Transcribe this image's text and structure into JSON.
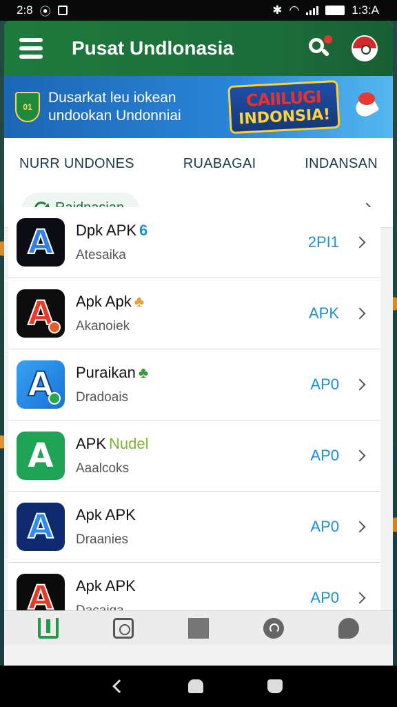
{
  "status_bar": {
    "time_left": "2:8",
    "time_right": "1:3:A"
  },
  "app_bar": {
    "title": "Pusat Undlonasia",
    "menu_icon": "hamburger-icon",
    "search_icon": "search-icon",
    "avatar_icon": "avatar-icon"
  },
  "banner": {
    "shield_text": "01",
    "text": "Dusarkat leu iokean undookan Undonniai",
    "promo_line1": "CAIILUGI",
    "promo_line2": "INDONSIA!"
  },
  "tabs": [
    {
      "label": "NURR UNDONES"
    },
    {
      "label": "RUABAGAI"
    },
    {
      "label": "INDANSAN"
    }
  ],
  "filter": {
    "chip_label": "Raidnasian"
  },
  "apps": [
    {
      "name": "Dpk APK",
      "accent": "6",
      "sub": "Atesaika",
      "tag": "2PI1",
      "icon_letter": "A"
    },
    {
      "name": "Apk Apk",
      "accent": "♣",
      "sub": "Akanoiek",
      "tag": "APK",
      "icon_letter": "A"
    },
    {
      "name": "Puraikan",
      "accent": "♣",
      "sub": "Dradoais",
      "tag": "AP0",
      "icon_letter": "A"
    },
    {
      "name": "APK ",
      "accent": "Nudel",
      "sub": "Aaalcoks",
      "tag": "AP0",
      "icon_letter": "A"
    },
    {
      "name": "Apk APK",
      "accent": "",
      "sub": "Draanies",
      "tag": "AP0",
      "icon_letter": "A"
    },
    {
      "name": "Apk APK",
      "accent": "",
      "sub": "Dacaiga",
      "tag": "AP0",
      "icon_letter": "A"
    }
  ],
  "colors": {
    "appbar": "#1e7a3c",
    "accent_blue": "#1c8fd6",
    "banner": "#2a85d8"
  }
}
